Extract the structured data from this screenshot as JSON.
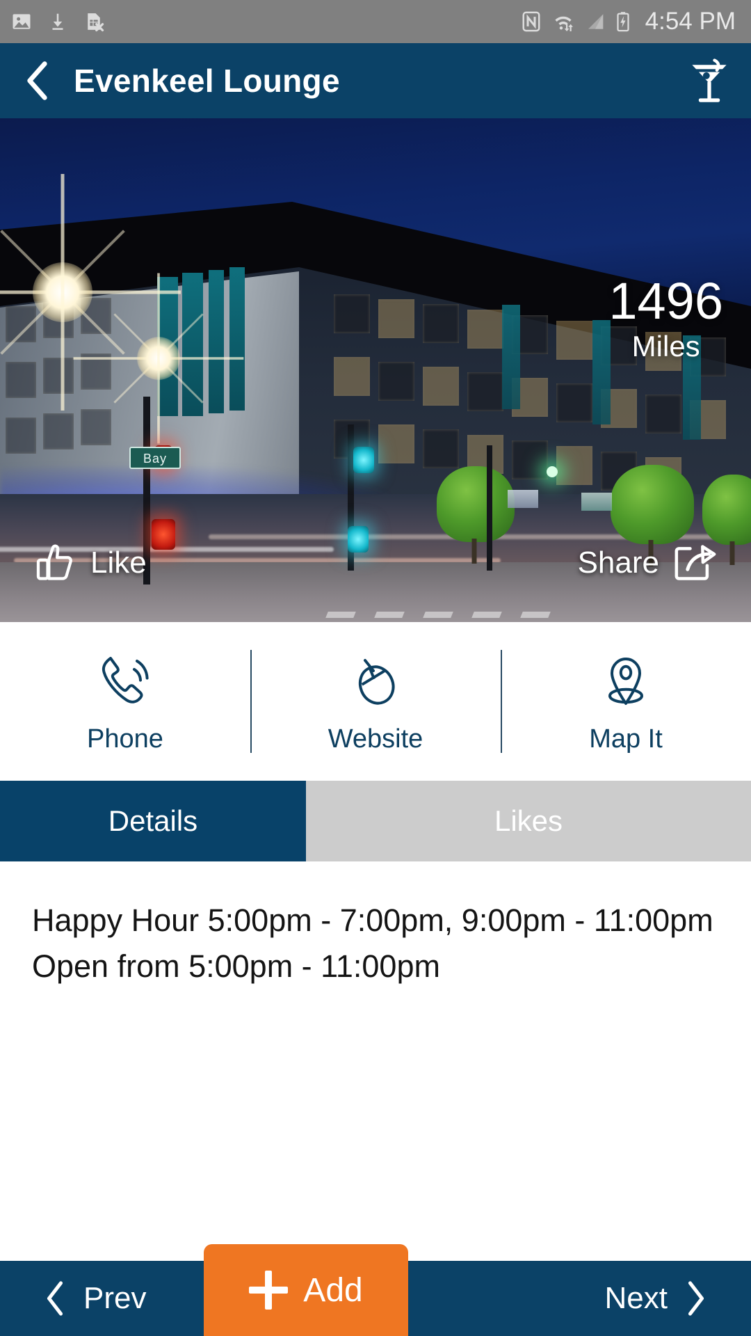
{
  "status_bar": {
    "time": "4:54 PM",
    "left_icons": [
      "image-icon",
      "download-icon",
      "sim-card-error-icon"
    ],
    "right_icons": [
      "nfc-icon",
      "wifi-icon",
      "signal-icon",
      "battery-charging-icon"
    ]
  },
  "header": {
    "back_icon": "chevron-left-icon",
    "title": "Evenkeel Lounge",
    "action_icon": "cocktail-glass-icon",
    "background_color": "#0b4267"
  },
  "hero": {
    "distance_value": "1496",
    "distance_unit": "Miles",
    "street_sign": "Bay",
    "like_label": "Like",
    "like_icon": "thumbs-up-icon",
    "share_label": "Share",
    "share_icon": "share-arrow-icon"
  },
  "actions": [
    {
      "label": "Phone",
      "icon": "phone-handset-icon"
    },
    {
      "label": "Website",
      "icon": "computer-mouse-icon"
    },
    {
      "label": "Map It",
      "icon": "map-pin-icon"
    }
  ],
  "tabs": [
    {
      "label": "Details",
      "active": true,
      "background_color": "#084269"
    },
    {
      "label": "Likes",
      "active": false,
      "background_color": "#cccccc"
    }
  ],
  "details": {
    "text": "Happy Hour 5:00pm - 7:00pm, 9:00pm - 11:00pm\nOpen from 5:00pm - 11:00pm"
  },
  "bottom_nav": {
    "prev_label": "Prev",
    "prev_icon": "chevron-left-icon",
    "add_label": "Add",
    "add_icon": "plus-icon",
    "add_color": "#ef7622",
    "next_label": "Next",
    "next_icon": "chevron-right-icon",
    "background_color": "#0b4267"
  }
}
